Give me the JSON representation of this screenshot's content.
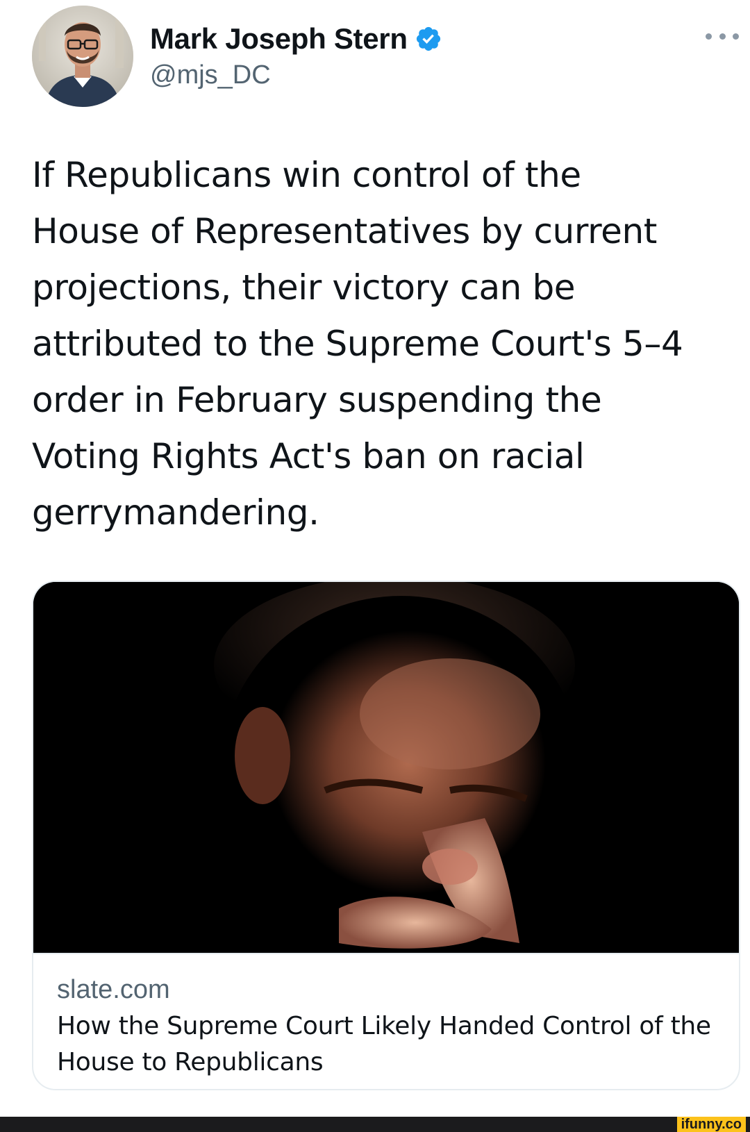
{
  "author": {
    "display_name": "Mark Joseph Stern",
    "handle": "@mjs_DC",
    "verified": true,
    "avatar_icon": "profile-photo"
  },
  "more_icon": "more-options-icon",
  "tweet": {
    "lines": [
      "If Republicans win control of the",
      "House of Representatives by current",
      "projections, their victory can be",
      "attributed to the Supreme Court's 5–4",
      "order in February suspending the",
      "Voting Rights Act's ban on racial",
      "gerrymandering."
    ]
  },
  "link_card": {
    "domain": "slate.com",
    "title": "How the Supreme Court Likely Handed Control of the House to Republicans",
    "image_icon": "article-photo"
  },
  "watermark": {
    "text": "ifunny.co"
  },
  "colors": {
    "text_primary": "#0f1419",
    "text_secondary": "#536471",
    "verified_blue": "#1d9bf0",
    "card_border": "#e6ecf0",
    "watermark_bg": "#fcc21b"
  }
}
